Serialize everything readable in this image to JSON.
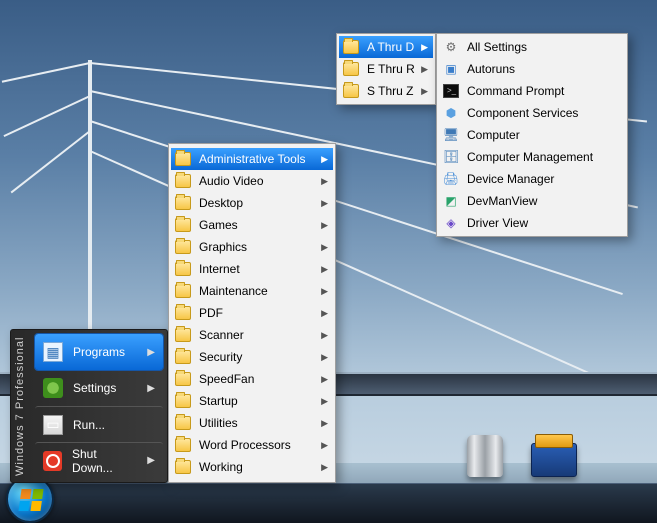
{
  "os_brand": "Windows  7   Professional",
  "start_menu": {
    "items": [
      {
        "label": "Programs",
        "icon": "programs-icon",
        "has_sub": true,
        "selected": true
      },
      {
        "label": "Settings",
        "icon": "settings-icon",
        "has_sub": true,
        "selected": false
      },
      {
        "label": "Run...",
        "icon": "run-icon",
        "has_sub": false,
        "selected": false
      },
      {
        "label": "Shut Down...",
        "icon": "shutdown-icon",
        "has_sub": true,
        "selected": false
      }
    ]
  },
  "programs_menu": {
    "items": [
      {
        "label": "Administrative Tools",
        "selected": true
      },
      {
        "label": "Audio Video",
        "selected": false
      },
      {
        "label": "Desktop",
        "selected": false
      },
      {
        "label": "Games",
        "selected": false
      },
      {
        "label": "Graphics",
        "selected": false
      },
      {
        "label": "Internet",
        "selected": false
      },
      {
        "label": "Maintenance",
        "selected": false
      },
      {
        "label": "PDF",
        "selected": false
      },
      {
        "label": "Scanner",
        "selected": false
      },
      {
        "label": "Security",
        "selected": false
      },
      {
        "label": "SpeedFan",
        "selected": false
      },
      {
        "label": "Startup",
        "selected": false
      },
      {
        "label": "Utilities",
        "selected": false
      },
      {
        "label": "Word Processors",
        "selected": false
      },
      {
        "label": "Working",
        "selected": false
      }
    ]
  },
  "admin_groups": {
    "items": [
      {
        "label": "A Thru D",
        "selected": true
      },
      {
        "label": "E Thru R",
        "selected": false
      },
      {
        "label": "S Thru Z",
        "selected": false
      }
    ]
  },
  "admin_a_d": {
    "items": [
      {
        "label": "All Settings",
        "icon": "gear-icon"
      },
      {
        "label": "Autoruns",
        "icon": "autoruns-icon"
      },
      {
        "label": "Command Prompt",
        "icon": "cmd-icon"
      },
      {
        "label": "Component Services",
        "icon": "component-services-icon"
      },
      {
        "label": "Computer",
        "icon": "computer-icon"
      },
      {
        "label": "Computer Management",
        "icon": "computer-management-icon"
      },
      {
        "label": "Device Manager",
        "icon": "device-manager-icon"
      },
      {
        "label": "DevManView",
        "icon": "devmanview-icon"
      },
      {
        "label": "Driver View",
        "icon": "driver-view-icon"
      }
    ]
  },
  "desktop_icons": {
    "trash": "Recycle Bin",
    "toolbox": "Tools"
  }
}
